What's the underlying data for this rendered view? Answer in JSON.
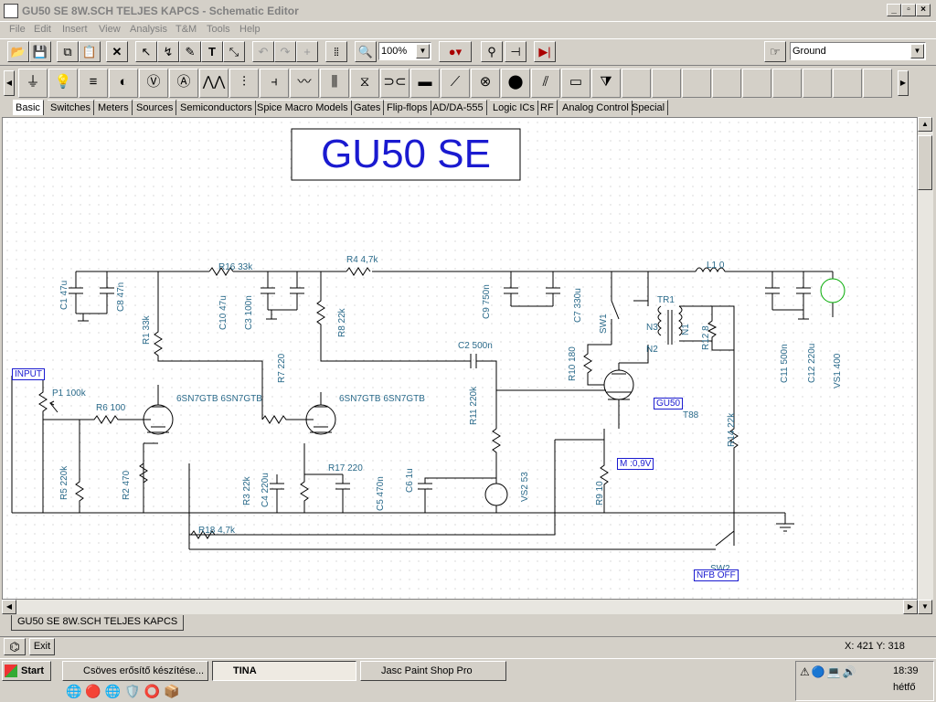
{
  "window": {
    "title": "GU50  SE  8W.SCH TELJES KAPCS - Schematic Editor"
  },
  "menu": [
    "File",
    "Edit",
    "Insert",
    "View",
    "Analysis",
    "T&M",
    "Tools",
    "Help"
  ],
  "toolbar": {
    "zoom": "100%",
    "net_select": "Ground"
  },
  "component_tabs": [
    "Basic",
    "Switches",
    "Meters",
    "Sources",
    "Semiconductors",
    "Spice Macro Models",
    "Gates",
    "Flip-flops",
    "AD/DA-555",
    "Logic ICs",
    "RF",
    "Analog Control",
    "Special"
  ],
  "schematic": {
    "title": "GU50 SE",
    "labels": {
      "input": "INPUT",
      "p1": "P1 100k",
      "r6": "R6 100",
      "r5": "R5 220k",
      "r2": "R2 470",
      "r1": "R1 33k",
      "c1": "C1 47u",
      "c8": "C8 47n",
      "r16": "R16 33k",
      "c10": "C10 47u",
      "c3": "C3 100n",
      "r4": "R4 4,7k",
      "r8": "R8 22k",
      "c9": "C9 750n",
      "c7": "C7 330u",
      "l1": "L1 0",
      "c11": "C11 500n",
      "c12": "C12 220u",
      "vs1": "VS1 400",
      "tr1": "TR1",
      "n3": "N3",
      "n2": "N2",
      "n1": "N1",
      "r12": "R12 8",
      "sw1": "SW1",
      "r10": "R10 180",
      "c2": "C2 500n",
      "r11": "R11 220k",
      "tube1": "6SN7GTB 6SN7GTB",
      "tube2": "6SN7GTB 6SN7GTB",
      "r7": "R7 220",
      "r17": "R17 220",
      "r3": "R3 22k",
      "c4": "C4 220u",
      "c5": "C5 470n",
      "c6": "C6 1u",
      "vs2": "VS2 53",
      "gu50": "GU50",
      "t88": "T88",
      "meter": "M :0,9V",
      "r9": "R9 10",
      "r14": "R14 22k",
      "r18": "R18 4,7k",
      "sw2": "SW2",
      "nfb": "NFB OFF"
    }
  },
  "doc_tab": "GU50  SE  8W.SCH TELJES KAPCS",
  "status": {
    "exit": "Exit",
    "coords": "X: 421  Y: 318"
  },
  "taskbar": {
    "start": "Start",
    "tasks": [
      "Csöves erősítő készítése...",
      "TINA",
      "Jasc Paint Shop Pro"
    ],
    "time": "18:39",
    "day": "hétfő"
  }
}
